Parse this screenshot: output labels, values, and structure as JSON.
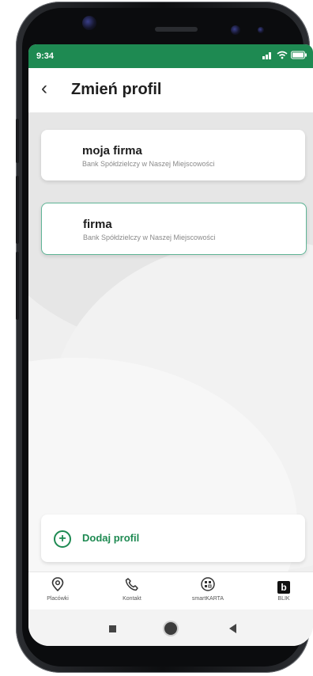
{
  "status_bar": {
    "time": "9:34"
  },
  "app_bar": {
    "back_icon": "chevron-left-icon",
    "title": "Zmień profil"
  },
  "profiles": [
    {
      "name": "moja firma",
      "bank": "Bank Spółdzielczy w Naszej Miejscowości",
      "selected": false
    },
    {
      "name": "firma",
      "bank": "Bank Spółdzielczy w Naszej Miejscowości",
      "selected": true
    }
  ],
  "add_profile": {
    "label": "Dodaj profil",
    "icon": "plus-circle-icon"
  },
  "bottom_nav": [
    {
      "label": "Placówki",
      "icon": "location-pin-icon"
    },
    {
      "label": "Kontakt",
      "icon": "phone-icon"
    },
    {
      "label": "smartKARTA",
      "icon": "smart-card-icon"
    },
    {
      "label": "BLIK",
      "icon": "blik-icon"
    }
  ],
  "colors": {
    "accent": "#1e8a52",
    "selected_border": "#5fb596",
    "background": "#efefef"
  }
}
